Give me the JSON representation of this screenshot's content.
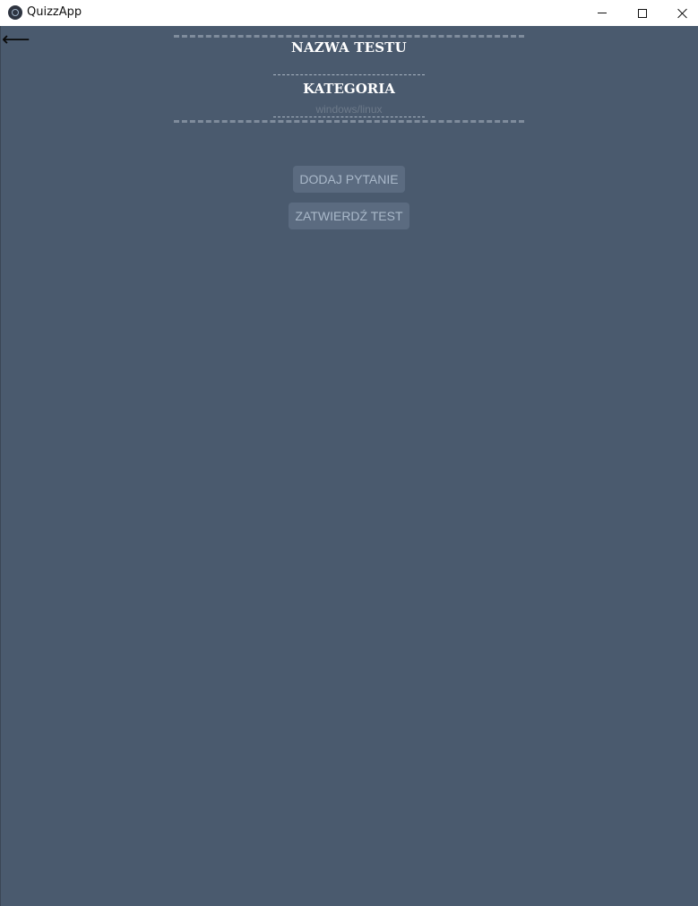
{
  "window": {
    "title": "QuizzApp",
    "icon": "app-logo-icon",
    "controls": {
      "minimize_icon": "minimize-icon",
      "maximize_icon": "maximize-icon",
      "close_icon": "close-icon"
    }
  },
  "nav": {
    "back_label": "⟵",
    "back_icon": "back-arrow-icon"
  },
  "form": {
    "name_label": "NAZWA TESTU",
    "category_label": "KATEGORIA",
    "category_placeholder": "windows/linux",
    "category_value": ""
  },
  "actions": {
    "add_question_label": "DODAJ PYTANIE",
    "confirm_test_label": "ZATWIERDŹ TEST"
  },
  "colors": {
    "background": "#4a5a6e",
    "button_bg": "#5b6b80",
    "button_text": "#a9b8c9",
    "heading_text": "#ffffff"
  }
}
